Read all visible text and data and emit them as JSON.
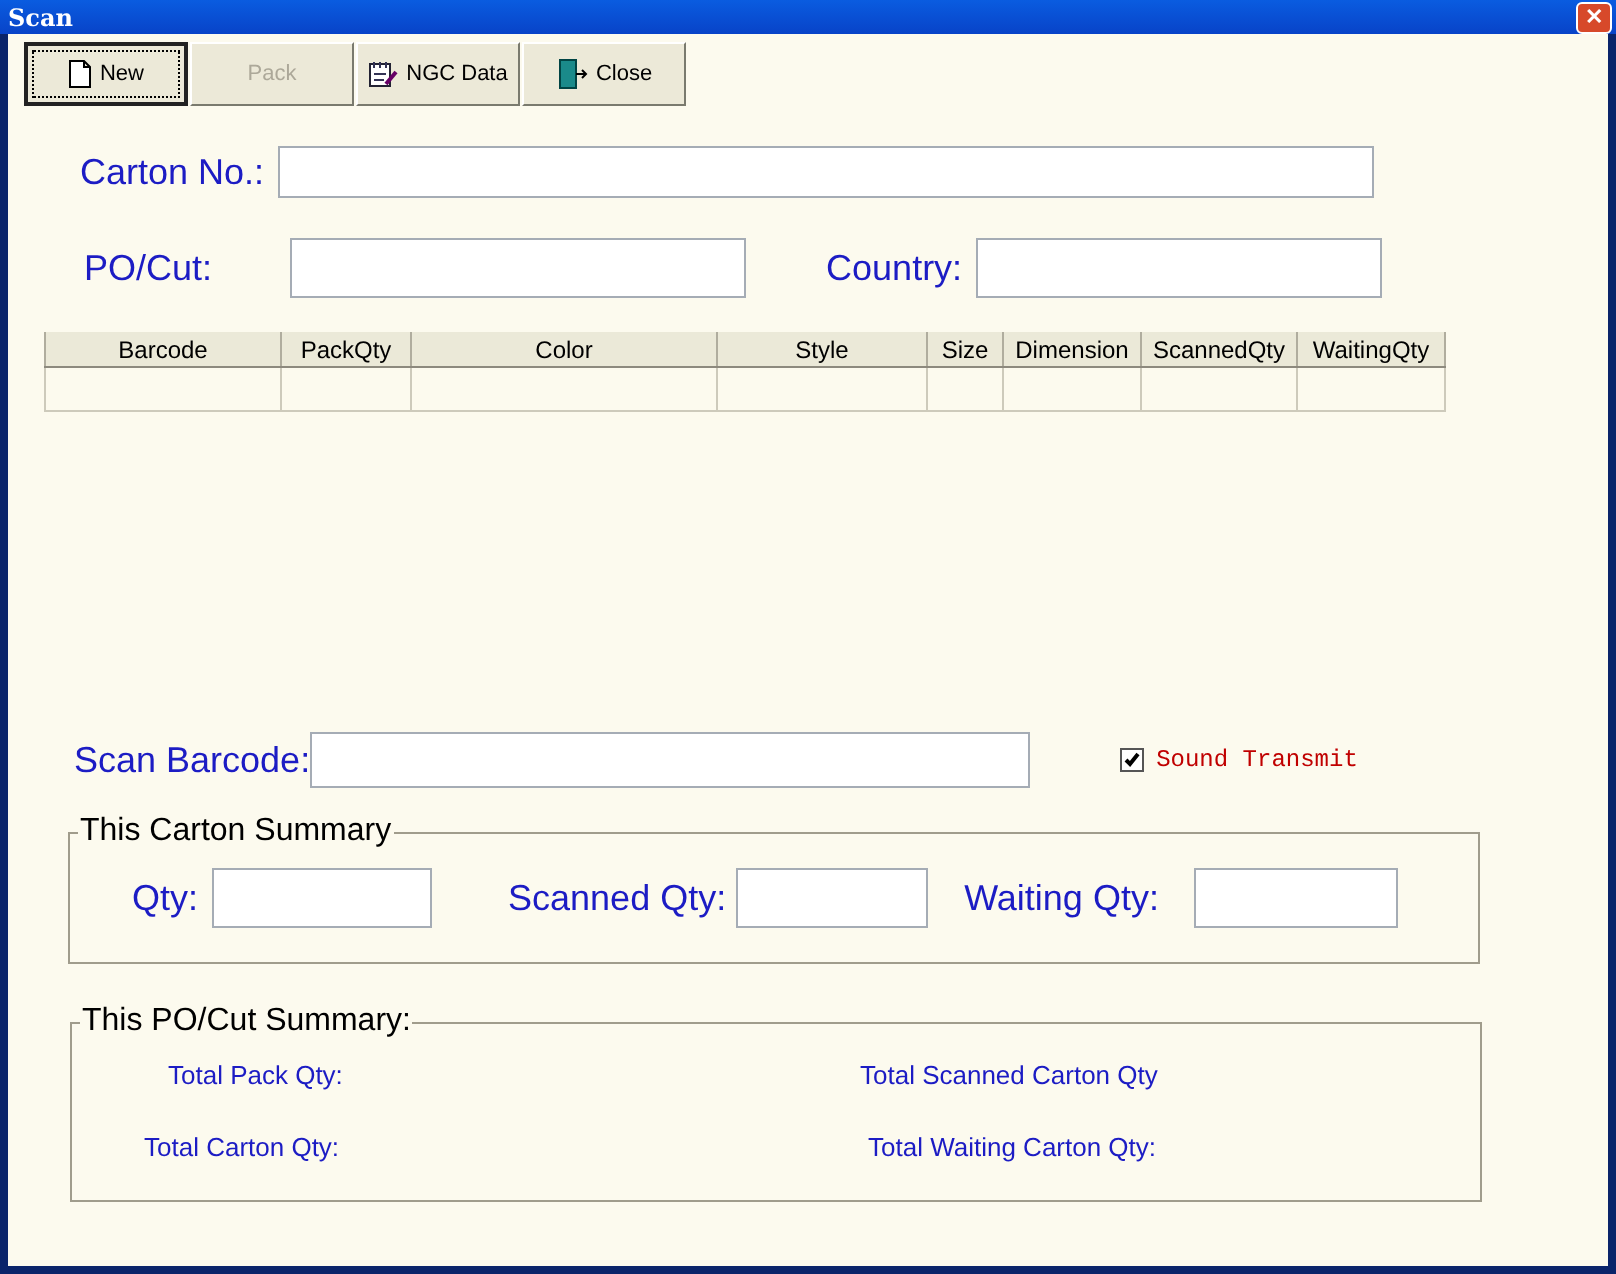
{
  "window": {
    "title": "Scan",
    "close": "✕"
  },
  "toolbar": [
    {
      "label": "New",
      "kind": "page",
      "disabled": false,
      "focused": true
    },
    {
      "label": "Pack",
      "kind": "plain",
      "disabled": true,
      "focused": false
    },
    {
      "label": "NGC Data",
      "kind": "edit",
      "disabled": false,
      "focused": false
    },
    {
      "label": "Close",
      "kind": "door",
      "disabled": false,
      "focused": false
    }
  ],
  "carton_no": {
    "label": "Carton No.:"
  },
  "po_cut": {
    "label": "PO/Cut:"
  },
  "country": {
    "label": "Country:"
  },
  "table": {
    "columns": [
      "Barcode",
      "PackQty",
      "Color",
      "Style",
      "Size",
      "Dimension",
      "ScannedQty",
      "WaitingQty"
    ]
  },
  "scan_barcode": {
    "label": "Scan Barcode:"
  },
  "sound_transmit": {
    "label": "Sound Transmit",
    "checked": true
  },
  "carton_summary": {
    "title": "This Carton Summary",
    "fields": [
      "Qty:",
      "Scanned Qty:",
      "Waiting Qty:"
    ]
  },
  "po_summary": {
    "title": "This PO/Cut Summary:",
    "items": [
      "Total Pack Qty:",
      "Total Scanned Carton Qty",
      "Total Carton Qty:",
      "Total Waiting Carton Qty:"
    ]
  }
}
